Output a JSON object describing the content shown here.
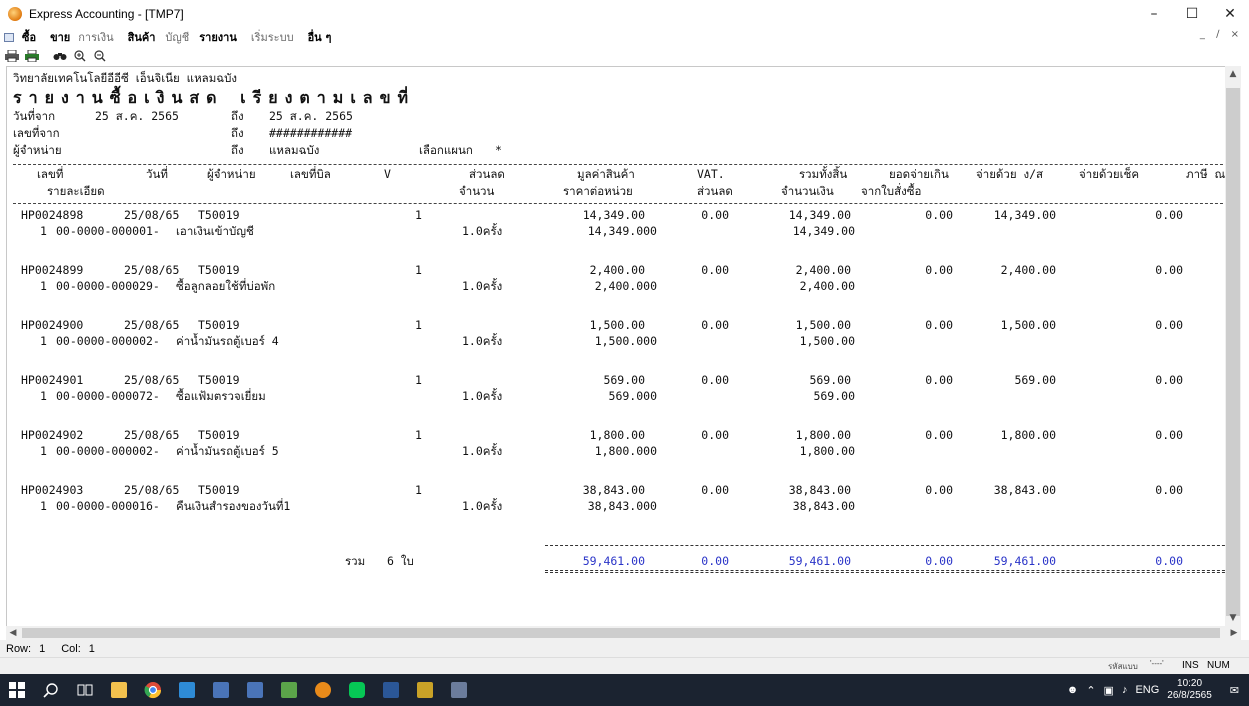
{
  "window": {
    "title": "Express Accounting - [TMP7]"
  },
  "menu": [
    "ซื้อ",
    "ขาย",
    "การเงิน",
    "สินค้า",
    "บัญชี",
    "รายงาน",
    "เริ่มระบบ",
    "อื่น ๆ"
  ],
  "report": {
    "org": "วิทยาลัยเทคโนโลยีอีอีซี เอ็นจิเนีย แหลมฉบัง",
    "title": "รายงานซื้อเงินสด เรียงตามเลขที่",
    "date_label": "วันที่จาก",
    "date_from": "25 ส.ค. 2565",
    "to_label": "ถึง",
    "date_to": "25 ส.ค. 2565",
    "doc_label": "เลขที่จาก",
    "doc_to": "############",
    "vendor_label": "ผู้จำหน่าย",
    "vendor_to": "แหลมฉบัง",
    "dept_label": "เลือกแผนก",
    "dept_value": "*",
    "headers1": [
      "เลขที่",
      "วันที่",
      "ผู้จำหน่าย",
      "เลขที่บิล",
      "V",
      "ส่วนลด",
      "มูลค่าสินค้า",
      "VAT.",
      "รวมทั้งสิ้น",
      "ยอดจ่ายเกิน",
      "จ่ายด้วย ง/ส",
      "จ่ายด้วยเช็ค",
      "ภาษี ณ"
    ],
    "headers2": [
      "รายละเอียด",
      "จำนวน",
      "ราคาต่อหน่วย",
      "ส่วนลด",
      "จำนวนเงิน",
      "จากใบสั่งซื้อ"
    ],
    "rows": [
      {
        "doc": "HP0024898",
        "date": "25/08/65",
        "vendor": "T50019",
        "v": "1",
        "amount": "14,349.00",
        "vat": "0.00",
        "total": "14,349.00",
        "over": "0.00",
        "cash": "14,349.00",
        "cheque": "0.00",
        "item_no": "1",
        "acct": "00-0000-000001-",
        "desc": "เอาเงินเข้าบัญชี",
        "qty": "1.0ครั้ง",
        "unit_price": "14,349.000",
        "line_amount": "14,349.00"
      },
      {
        "doc": "HP0024899",
        "date": "25/08/65",
        "vendor": "T50019",
        "v": "1",
        "amount": "2,400.00",
        "vat": "0.00",
        "total": "2,400.00",
        "over": "0.00",
        "cash": "2,400.00",
        "cheque": "0.00",
        "item_no": "1",
        "acct": "00-0000-000029-",
        "desc": "ซื้อลูกลอยใช้ที่บ่อพัก",
        "qty": "1.0ครั้ง",
        "unit_price": "2,400.000",
        "line_amount": "2,400.00"
      },
      {
        "doc": "HP0024900",
        "date": "25/08/65",
        "vendor": "T50019",
        "v": "1",
        "amount": "1,500.00",
        "vat": "0.00",
        "total": "1,500.00",
        "over": "0.00",
        "cash": "1,500.00",
        "cheque": "0.00",
        "item_no": "1",
        "acct": "00-0000-000002-",
        "desc": "ค่าน้ำมันรถตู้เบอร์ 4",
        "qty": "1.0ครั้ง",
        "unit_price": "1,500.000",
        "line_amount": "1,500.00"
      },
      {
        "doc": "HP0024901",
        "date": "25/08/65",
        "vendor": "T50019",
        "v": "1",
        "amount": "569.00",
        "vat": "0.00",
        "total": "569.00",
        "over": "0.00",
        "cash": "569.00",
        "cheque": "0.00",
        "item_no": "1",
        "acct": "00-0000-000072-",
        "desc": "ซื้อแฟ้มตรวจเยี่ยม",
        "qty": "1.0ครั้ง",
        "unit_price": "569.000",
        "line_amount": "569.00"
      },
      {
        "doc": "HP0024902",
        "date": "25/08/65",
        "vendor": "T50019",
        "v": "1",
        "amount": "1,800.00",
        "vat": "0.00",
        "total": "1,800.00",
        "over": "0.00",
        "cash": "1,800.00",
        "cheque": "0.00",
        "item_no": "1",
        "acct": "00-0000-000002-",
        "desc": "ค่าน้ำมันรถตู้เบอร์ 5",
        "qty": "1.0ครั้ง",
        "unit_price": "1,800.000",
        "line_amount": "1,800.00"
      },
      {
        "doc": "HP0024903",
        "date": "25/08/65",
        "vendor": "T50019",
        "v": "1",
        "amount": "38,843.00",
        "vat": "0.00",
        "total": "38,843.00",
        "over": "0.00",
        "cash": "38,843.00",
        "cheque": "0.00",
        "item_no": "1",
        "acct": "00-0000-000016-",
        "desc": "คืนเงินสำรองของวันที่1",
        "qty": "1.0ครั้ง",
        "unit_price": "38,843.000",
        "line_amount": "38,843.00"
      }
    ],
    "summary": {
      "label": "รวม",
      "count": "6 ใบ",
      "amount": "59,461.00",
      "vat": "0.00",
      "total": "59,461.00",
      "over": "0.00",
      "cash": "59,461.00",
      "cheque": "0.00"
    }
  },
  "status": {
    "row_label": "Row:",
    "row": "1",
    "col_label": "Col:",
    "col": "1",
    "ins": "INS",
    "num": "NUM",
    "small": "รหัสแบบ",
    "dash": "'----'"
  },
  "taskbar": {
    "lang": "ENG",
    "time": "10:20",
    "date": "26/8/2565"
  }
}
